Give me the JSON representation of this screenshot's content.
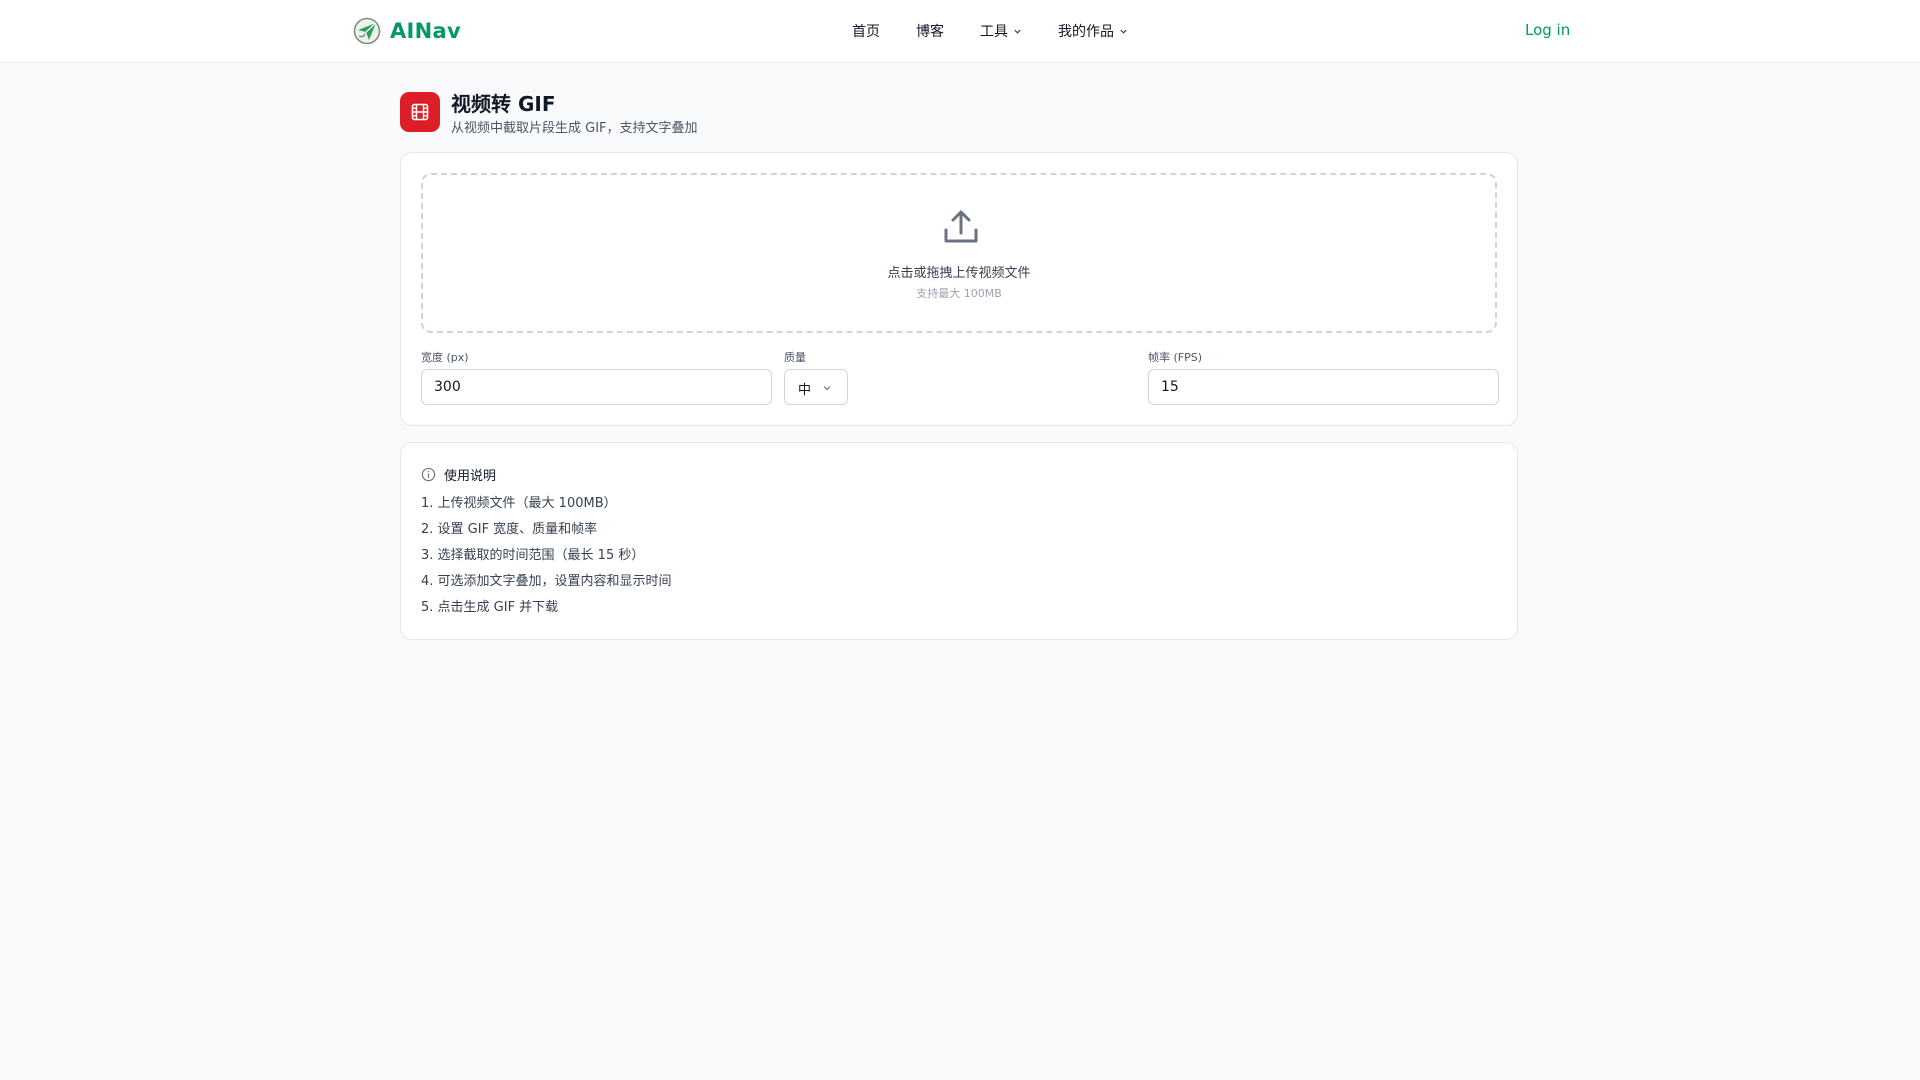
{
  "header": {
    "brand": "AINav",
    "nav": [
      {
        "label": "首页",
        "has_menu": false
      },
      {
        "label": "博客",
        "has_menu": false
      },
      {
        "label": "工具",
        "has_menu": true
      },
      {
        "label": "我的作品",
        "has_menu": true
      }
    ],
    "login_label": "Log in",
    "accent_color": "#059669"
  },
  "tool": {
    "title": "视频转 GIF",
    "subtitle": "从视频中截取片段生成 GIF，支持文字叠加",
    "icon": "film-icon",
    "icon_color": "#dc1f26"
  },
  "upload": {
    "title": "点击或拖拽上传视频文件",
    "hint": "支持最大 100MB",
    "icon": "upload-icon"
  },
  "settings": {
    "width": {
      "label": "宽度 (px)",
      "value": "300"
    },
    "quality": {
      "label": "质量",
      "value": "中"
    },
    "fps": {
      "label": "帧率 (FPS)",
      "value": "15"
    }
  },
  "instructions": {
    "title": "使用说明",
    "icon": "info-icon",
    "steps": [
      "1. 上传视频文件（最大 100MB）",
      "2. 设置 GIF 宽度、质量和帧率",
      "3. 选择截取的时间范围（最长 15 秒）",
      "4. 可选添加文字叠加，设置内容和显示时间",
      "5. 点击生成 GIF 并下载"
    ]
  }
}
